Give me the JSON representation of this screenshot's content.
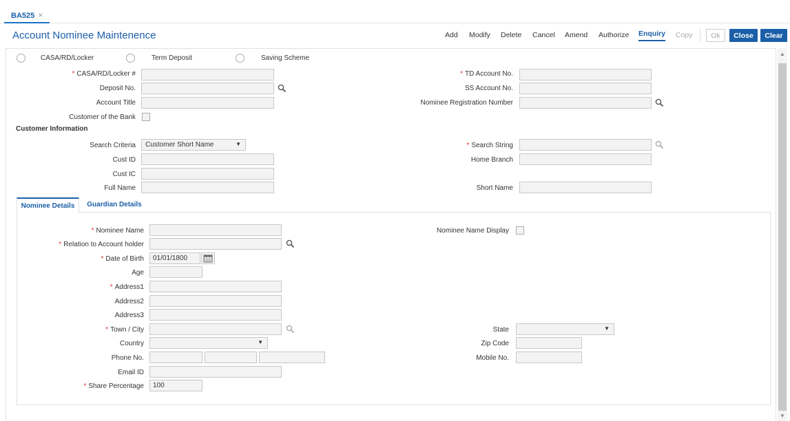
{
  "tab": {
    "label": "BA525",
    "close": "×"
  },
  "title": "Account Nominee Maintenence",
  "toolbar": {
    "add": "Add",
    "modify": "Modify",
    "delete": "Delete",
    "cancel": "Cancel",
    "amend": "Amend",
    "authorize": "Authorize",
    "enquiry": "Enquiry",
    "copy": "Copy",
    "ok": "Ok",
    "close": "Close",
    "clear": "Clear"
  },
  "account_type": {
    "options": [
      "CASA/RD/Locker",
      "Term Deposit",
      "Saving Scheme"
    ]
  },
  "account": {
    "casa_label": "CASA/RD/Locker #",
    "deposit_label": "Deposit No.",
    "title_label": "Account Title",
    "customer_of_bank_label": "Customer of the Bank",
    "td_label": "TD Account No.",
    "ss_label": "SS Account No.",
    "nominee_reg_label": "Nominee Registration Number"
  },
  "customer_info": {
    "heading": "Customer Information",
    "search_criteria_label": "Search Criteria",
    "search_criteria_value": "Customer Short Name",
    "search_string_label": "Search String",
    "cust_id_label": "Cust ID",
    "cust_ic_label": "Cust IC",
    "full_name_label": "Full Name",
    "home_branch_label": "Home Branch",
    "short_name_label": "Short Name"
  },
  "tabs": {
    "nominee": "Nominee Details",
    "guardian": "Guardian Details"
  },
  "nominee": {
    "name_label": "Nominee Name",
    "name_display_label": "Nominee Name Display",
    "relation_label": "Relation to Account holder",
    "dob_label": "Date of Birth",
    "dob_value": "01/01/1800",
    "age_label": "Age",
    "address1_label": "Address1",
    "address2_label": "Address2",
    "address3_label": "Address3",
    "town_label": "Town / City",
    "state_label": "State",
    "country_label": "Country",
    "zip_label": "Zip Code",
    "phone_label": "Phone No.",
    "mobile_label": "Mobile No.",
    "email_label": "Email ID",
    "share_label": "Share Percentage",
    "share_value": "100"
  },
  "required_marker": "*",
  "colors": {
    "brand": "#1b5fa8",
    "required": "#e0302a",
    "field_bg": "#f3f3f3"
  }
}
